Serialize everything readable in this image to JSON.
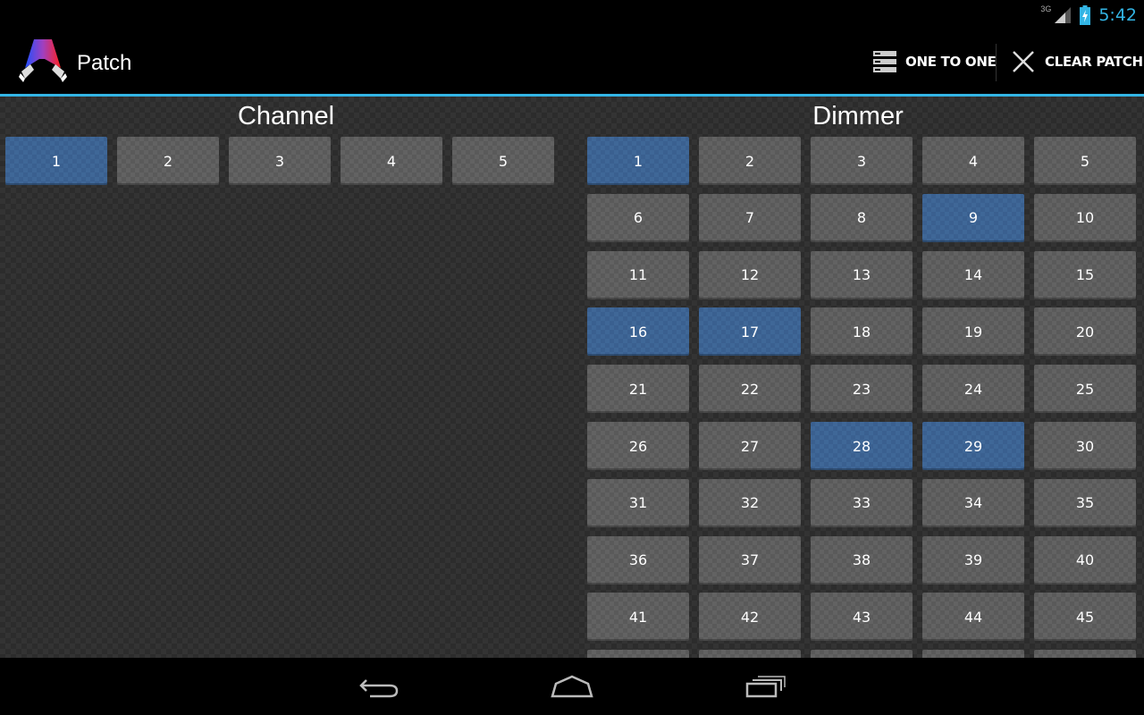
{
  "status_bar": {
    "network": "3G",
    "time": "5:42"
  },
  "action_bar": {
    "title": "Patch",
    "one_to_one_label": "ONE TO ONE",
    "clear_patch_label": "CLEAR PATCH",
    "accent_color": "#33b5e5"
  },
  "channel_panel": {
    "title": "Channel",
    "cells": [
      "1",
      "2",
      "3",
      "4",
      "5"
    ],
    "selected": [
      "1"
    ]
  },
  "dimmer_panel": {
    "title": "Dimmer",
    "cells": [
      "1",
      "2",
      "3",
      "4",
      "5",
      "6",
      "7",
      "8",
      "9",
      "10",
      "11",
      "12",
      "13",
      "14",
      "15",
      "16",
      "17",
      "18",
      "19",
      "20",
      "21",
      "22",
      "23",
      "24",
      "25",
      "26",
      "27",
      "28",
      "29",
      "30",
      "31",
      "32",
      "33",
      "34",
      "35",
      "36",
      "37",
      "38",
      "39",
      "40",
      "41",
      "42",
      "43",
      "44",
      "45"
    ],
    "selected": [
      "1",
      "9",
      "16",
      "17",
      "28",
      "29"
    ]
  },
  "colors": {
    "selected_cell": "#3a6090",
    "unselected_cell": "#5a5a5a",
    "background": "#2c2c2c"
  },
  "nav_bar": {
    "icons": [
      "back-icon",
      "home-icon",
      "recents-icon"
    ]
  }
}
